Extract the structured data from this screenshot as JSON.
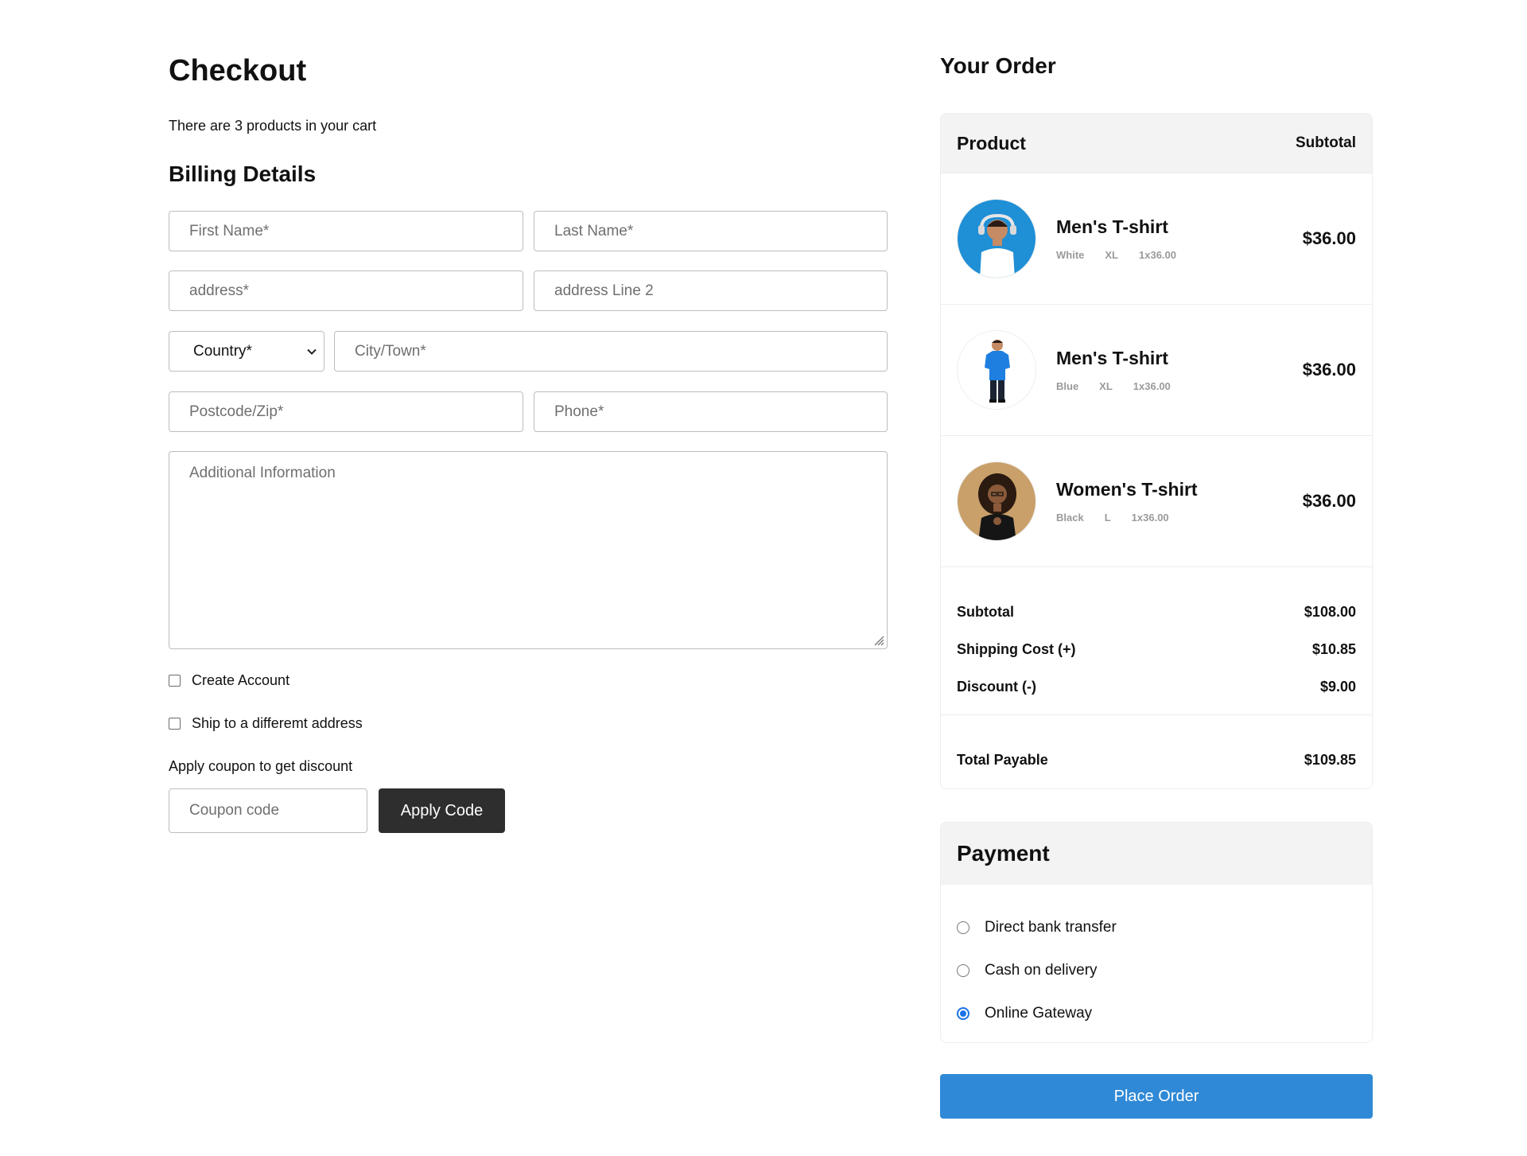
{
  "checkout": {
    "title": "Checkout",
    "cart_count_text": "There are 3 products in your cart",
    "billing_title": "Billing Details",
    "fields": {
      "first_name": "First Name*",
      "last_name": "Last Name*",
      "address": "address*",
      "address_line2": "address Line 2",
      "country": "Country*",
      "city": "City/Town*",
      "postcode": "Postcode/Zip*",
      "phone": "Phone*",
      "additional_info": "Additional Information"
    },
    "create_account_label": "Create Account",
    "ship_different_label": "Ship to a differemt address",
    "coupon_hint": "Apply coupon to get discount",
    "coupon_placeholder": "Coupon code",
    "apply_button": "Apply Code"
  },
  "order": {
    "title": "Your Order",
    "header_product": "Product",
    "header_subtotal": "Subtotal",
    "items": [
      {
        "name": "Men's T-shirt",
        "color": "White",
        "size": "XL",
        "qty_price": "1x36.00",
        "price": "$36.00",
        "icon": "man-white-tshirt-photo",
        "bg": "#1f8fd6"
      },
      {
        "name": "Men's T-shirt",
        "color": "Blue",
        "size": "XL",
        "qty_price": "1x36.00",
        "price": "$36.00",
        "icon": "man-blue-tshirt-photo",
        "bg": "#ffffff"
      },
      {
        "name": "Women's T-shirt",
        "color": "Black",
        "size": "L",
        "qty_price": "1x36.00",
        "price": "$36.00",
        "icon": "woman-black-tshirt-photo",
        "bg": "#c9a06a"
      }
    ],
    "subtotal_label": "Subtotal",
    "subtotal_value": "$108.00",
    "shipping_label": "Shipping Cost (+)",
    "shipping_value": "$10.85",
    "discount_label": "Discount (-)",
    "discount_value": "$9.00",
    "total_label": "Total Payable",
    "total_value": "$109.85"
  },
  "payment": {
    "title": "Payment",
    "options": [
      "Direct bank transfer",
      "Cash on delivery",
      "Online Gateway"
    ],
    "selected": "Online Gateway",
    "accent_color": "#1a73e8"
  },
  "place_order_label": "Place Order",
  "colors": {
    "primary_button": "#2f89d6",
    "dark_button": "#2e2e2e"
  }
}
